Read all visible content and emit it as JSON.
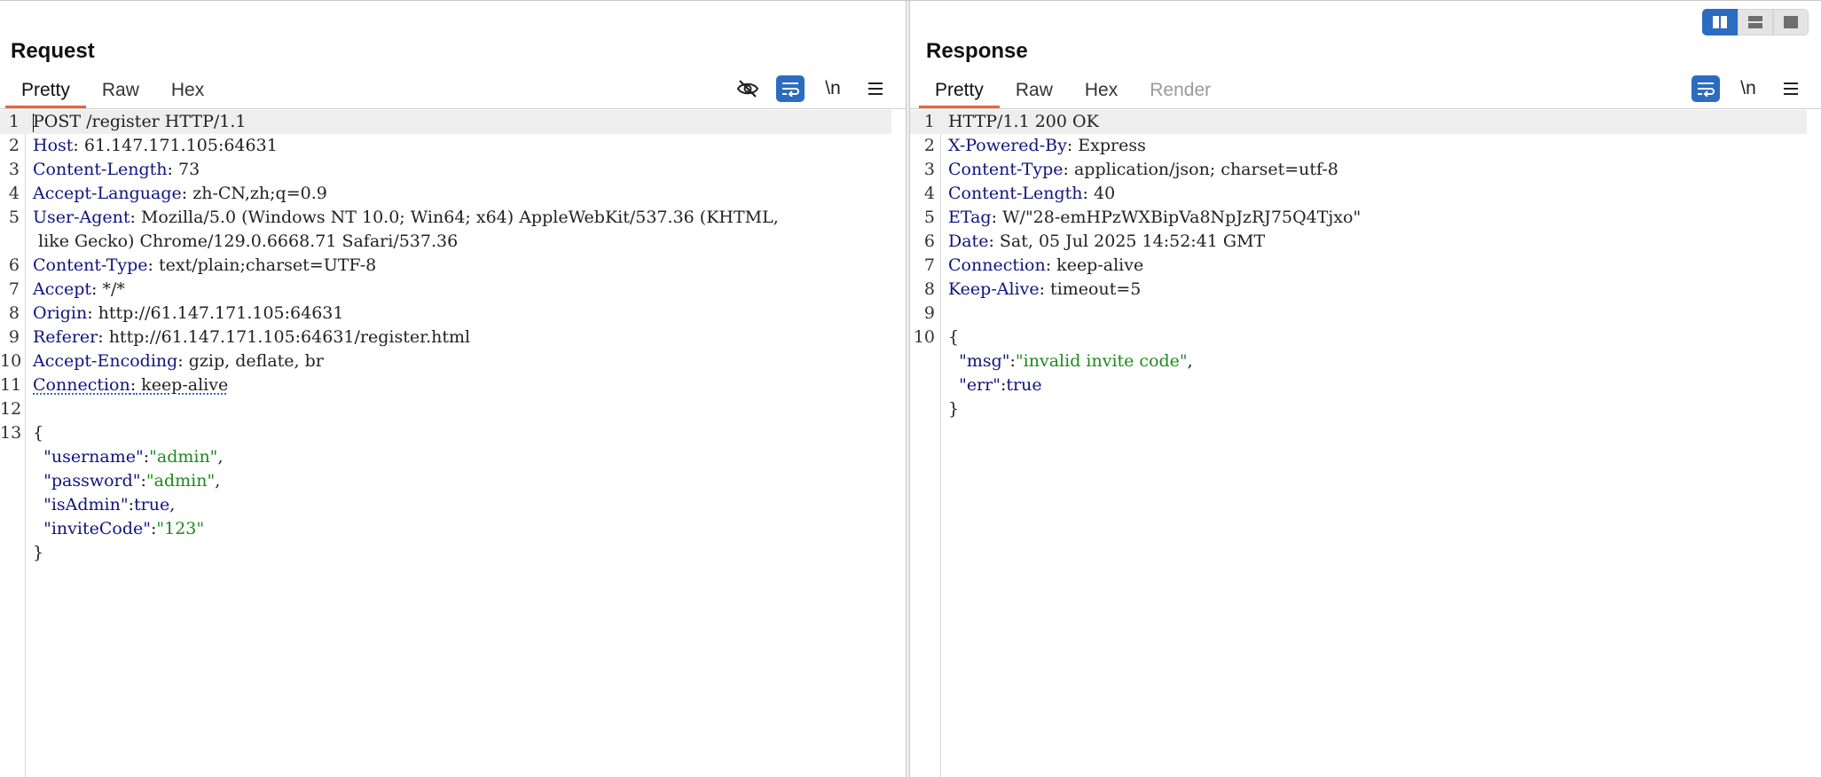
{
  "layout_buttons": [
    {
      "name": "split-horizontal",
      "active": true
    },
    {
      "name": "split-vertical",
      "active": false
    },
    {
      "name": "single",
      "active": false
    }
  ],
  "request": {
    "title": "Request",
    "tabs": [
      "Pretty",
      "Raw",
      "Hex"
    ],
    "active_tab": "Pretty",
    "tools": {
      "hide_icon": "eye-off-icon",
      "wrap_icon": "word-wrap-icon",
      "newline_label": "\\n",
      "menu_icon": "hamburger-menu-icon"
    },
    "lines": [
      {
        "num": "1",
        "text": "POST /register HTTP/1.1"
      },
      {
        "num": "2",
        "key": "Host",
        "value": " 61.147.171.105:64631"
      },
      {
        "num": "3",
        "key": "Content-Length",
        "value": " 73"
      },
      {
        "num": "4",
        "key": "Accept-Language",
        "value": " zh-CN,zh;q=0.9"
      },
      {
        "num": "5",
        "key": "User-Agent",
        "value": " Mozilla/5.0 (Windows NT 10.0; Win64; x64) AppleWebKit/537.36 (KHTML,"
      },
      {
        "num": "",
        "text": " like Gecko) Chrome/129.0.6668.71 Safari/537.36"
      },
      {
        "num": "6",
        "key": "Content-Type",
        "value": " text/plain;charset=UTF-8"
      },
      {
        "num": "7",
        "key": "Accept",
        "value": " */*"
      },
      {
        "num": "8",
        "key": "Origin",
        "value": " http://61.147.171.105:64631"
      },
      {
        "num": "9",
        "key": "Referer",
        "value": " http://61.147.171.105:64631/register.html"
      },
      {
        "num": "10",
        "key": "Accept-Encoding",
        "value": " gzip, deflate, br"
      },
      {
        "num": "11",
        "key": "Connection",
        "value": " keep-alive"
      },
      {
        "num": "12",
        "text": ""
      },
      {
        "num": "13",
        "text": "{"
      },
      {
        "num": "",
        "json_key": "\"username\"",
        "json_val": "\"admin\"",
        "val_type": "str",
        "comma": ","
      },
      {
        "num": "",
        "json_key": "\"password\"",
        "json_val": "\"admin\"",
        "val_type": "str",
        "comma": ","
      },
      {
        "num": "",
        "json_key": "\"isAdmin\"",
        "json_val": "true",
        "val_type": "lit",
        "comma": ","
      },
      {
        "num": "",
        "json_key": "\"inviteCode\"",
        "json_val": "\"123\"",
        "val_type": "str",
        "comma": ""
      },
      {
        "num": "",
        "text": "}"
      }
    ]
  },
  "response": {
    "title": "Response",
    "tabs": [
      "Pretty",
      "Raw",
      "Hex",
      "Render"
    ],
    "active_tab": "Pretty",
    "tools": {
      "wrap_icon": "word-wrap-icon",
      "newline_label": "\\n",
      "menu_icon": "hamburger-menu-icon"
    },
    "lines": [
      {
        "num": "1",
        "text": "HTTP/1.1 200 OK"
      },
      {
        "num": "2",
        "key": "X-Powered-By",
        "value": " Express"
      },
      {
        "num": "3",
        "key": "Content-Type",
        "value": " application/json; charset=utf-8"
      },
      {
        "num": "4",
        "key": "Content-Length",
        "value": " 40"
      },
      {
        "num": "5",
        "key": "ETag",
        "value": " W/\"28-emHPzWXBipVa8NpJzRJ75Q4Tjxo\""
      },
      {
        "num": "6",
        "key": "Date",
        "value": " Sat, 05 Jul 2025 14:52:41 GMT"
      },
      {
        "num": "7",
        "key": "Connection",
        "value": " keep-alive"
      },
      {
        "num": "8",
        "key": "Keep-Alive",
        "value": " timeout=5"
      },
      {
        "num": "9",
        "text": ""
      },
      {
        "num": "10",
        "text": "{"
      },
      {
        "num": "",
        "json_key": "\"msg\"",
        "json_val": "\"invalid invite code\"",
        "val_type": "str",
        "comma": ","
      },
      {
        "num": "",
        "json_key": "\"err\"",
        "json_val": "true",
        "val_type": "lit",
        "comma": ""
      },
      {
        "num": "",
        "text": "}"
      }
    ]
  }
}
